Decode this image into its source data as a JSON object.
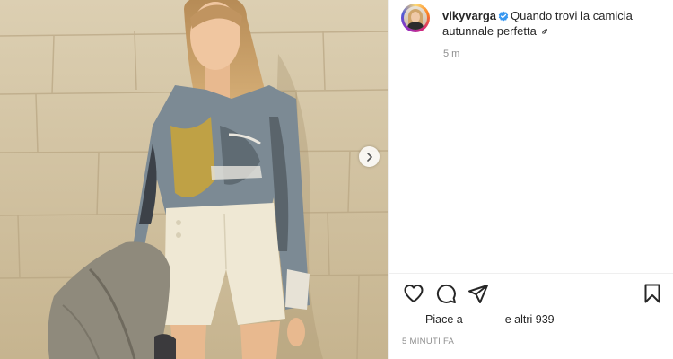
{
  "post": {
    "username": "vikyvarga",
    "caption": "Quando trovi la camicia autunnale perfetta",
    "caption_emoji": "leaf-emoji",
    "timestamp_short": "5 m",
    "likes_prefix": "Piace a",
    "likes_suffix": "e altri 939",
    "posted_ago": "5 MINUTI FA"
  },
  "icons": {
    "verified": "verified-badge-icon",
    "like": "heart-icon",
    "comment": "comment-icon",
    "share": "paper-plane-icon",
    "save": "bookmark-icon",
    "carousel_next": "chevron-right-icon"
  },
  "colors": {
    "verified_blue": "#3897f0",
    "text_primary": "#262626",
    "text_secondary": "#8e8e8e"
  }
}
